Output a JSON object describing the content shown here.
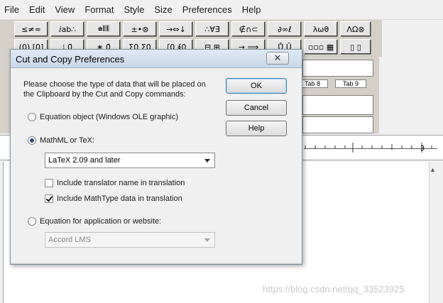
{
  "menubar": {
    "items": [
      "File",
      "Edit",
      "View",
      "Format",
      "Style",
      "Size",
      "Preferences",
      "Help"
    ]
  },
  "palette": {
    "row1": [
      "≤≠≈",
      "ⅈab∴",
      "⩧⦀⦀",
      "±•⊗",
      "→⇔↓",
      "∴∀∃",
      "∉∩⊂",
      "∂∞ℓ",
      "λωθ",
      "ΛΩ⊗"
    ],
    "row2": [
      "(0) [0]",
      "⁝ 0̄",
      "∗ 0̂",
      "Σ0 Σ0",
      "∫0 ∮0",
      "⊟ ⊞",
      "→ ⟹",
      "Ů Ű",
      "▫▫▫ ▦",
      "▯ ▯"
    ]
  },
  "tabs": [
    "Tab 8",
    "Tab 9"
  ],
  "ruler": {
    "number": "3"
  },
  "dialog": {
    "title": "Cut and Copy Preferences",
    "close_label": "✕",
    "description": "Please choose the type of data that will be placed on the Clipboard by the Cut and Copy commands:",
    "ok_label": "OK",
    "cancel_label": "Cancel",
    "help_label": "Help",
    "option_equation_object": "Equation object (Windows OLE graphic)",
    "option_mathml_tex": "MathML or TeX:",
    "tex_select_value": "LaTeX 2.09 and later",
    "check_translator_name": "Include translator name in translation",
    "check_mathtype_data": "Include MathType data in translation",
    "option_application": "Equation for application or website:",
    "app_select_value": "Accord LMS"
  },
  "watermark": "https://blog.csdn.net/qq_33523925"
}
